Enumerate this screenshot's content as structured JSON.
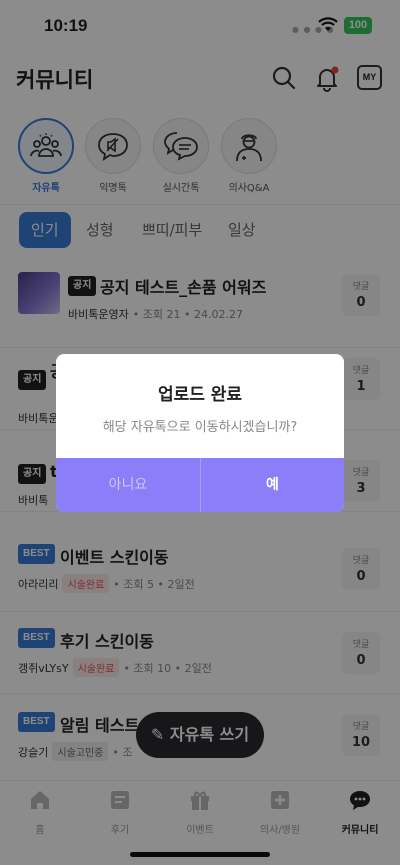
{
  "status": {
    "time": "10:19",
    "battery": "100"
  },
  "header": {
    "title": "커뮤니티",
    "my_label": "MY"
  },
  "categories": [
    {
      "label": "자유톡",
      "icon": "people-icon",
      "active": true
    },
    {
      "label": "익명톡",
      "icon": "anonymous-chat-icon",
      "active": false
    },
    {
      "label": "실시간톡",
      "icon": "live-chat-icon",
      "active": false
    },
    {
      "label": "의사Q&A",
      "icon": "doctor-icon",
      "active": false
    }
  ],
  "tabs": [
    "인기",
    "성형",
    "쁘띠/피부",
    "일상"
  ],
  "posts": [
    {
      "badge": "공지",
      "title": "공지 테스트_손품 어워즈",
      "author": "바비톡운영자",
      "views": "조회 21",
      "date": "24.02.27",
      "comment_label": "댓글",
      "comments": "0"
    },
    {
      "badge": "공지",
      "title": "공",
      "author": "바비톡운",
      "comment_label": "댓글",
      "comments": "1"
    },
    {
      "badge": "공지",
      "title": "t",
      "author": "바비톡",
      "comment_label": "댓글",
      "comments": "3"
    },
    {
      "badge": "BEST",
      "title": "이벤트 스킨이동",
      "author": "아라리리",
      "tag": "시술완료",
      "views": "조회 5",
      "date": "2일전",
      "comment_label": "댓글",
      "comments": "0"
    },
    {
      "badge": "BEST",
      "title": "후기 스킨이동",
      "author": "갱쥐vLYsY",
      "tag": "시술완료",
      "views": "조회 10",
      "date": "2일전",
      "comment_label": "댓글",
      "comments": "0"
    },
    {
      "badge": "BEST",
      "title": "알림 테스트",
      "author": "강슬기",
      "tag": "시술고민중",
      "views": "조",
      "comment_label": "댓글",
      "comments": "10"
    }
  ],
  "fab": {
    "label": "자유톡 쓰기"
  },
  "bottom_nav": [
    {
      "label": "홈",
      "active": false
    },
    {
      "label": "후기",
      "active": false
    },
    {
      "label": "이벤트",
      "active": false
    },
    {
      "label": "의사/병원",
      "active": false
    },
    {
      "label": "커뮤니티",
      "active": true
    }
  ],
  "dialog": {
    "title": "업로드 완료",
    "message": "해당 자유톡으로 이동하시겠습니까?",
    "no_label": "아니요",
    "yes_label": "예"
  },
  "colors": {
    "accent": "#3a7bd5",
    "dialog_button": "#8b7ef8",
    "overlay": "rgba(0,0,0,0.45)"
  }
}
